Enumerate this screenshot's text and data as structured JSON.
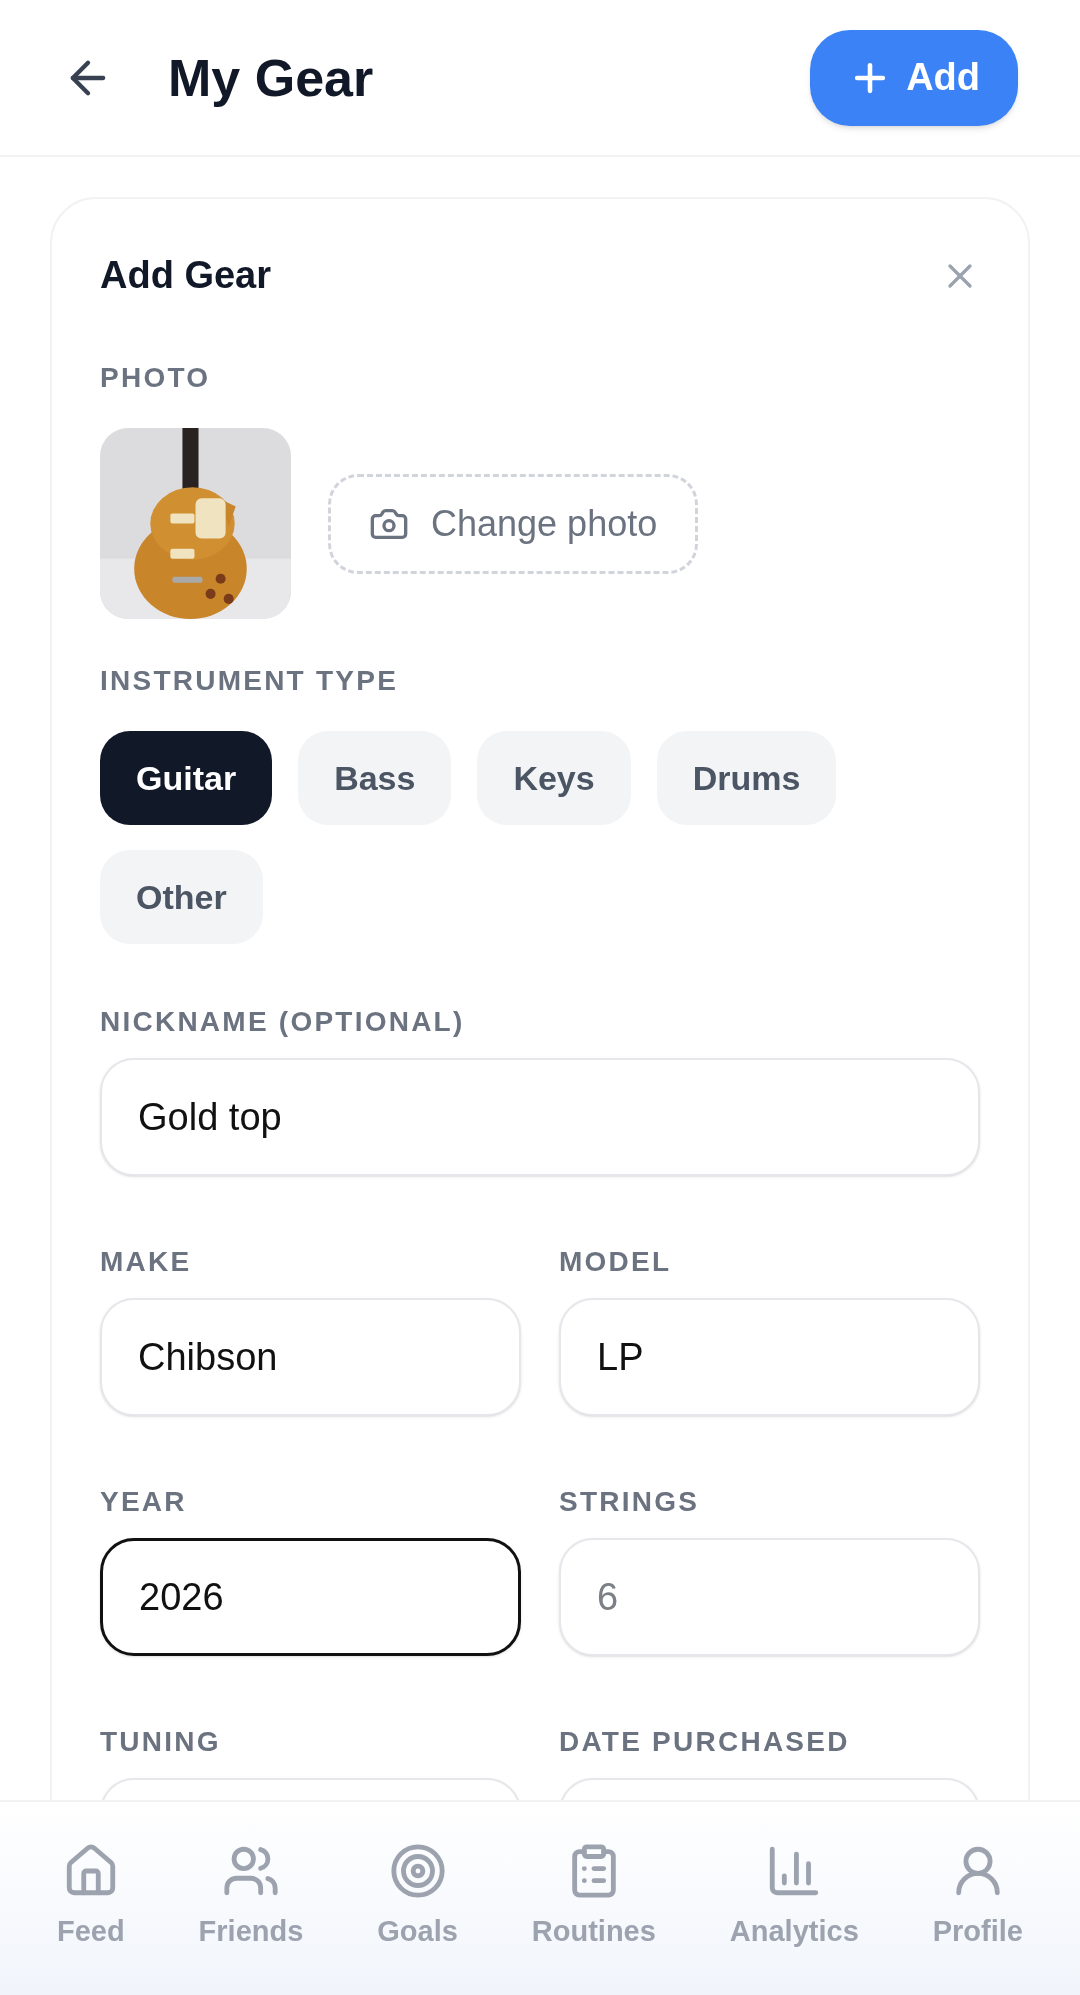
{
  "header": {
    "title": "My Gear",
    "add_button": "Add"
  },
  "form": {
    "title": "Add Gear",
    "photo_label": "PHOTO",
    "change_photo": "Change photo",
    "type_label": "INSTRUMENT TYPE",
    "types": [
      {
        "label": "Guitar",
        "selected": true
      },
      {
        "label": "Bass",
        "selected": false
      },
      {
        "label": "Keys",
        "selected": false
      },
      {
        "label": "Drums",
        "selected": false
      },
      {
        "label": "Other",
        "selected": false
      }
    ],
    "fields": [
      {
        "label": "NICKNAME (OPTIONAL)",
        "value": "Gold top",
        "focused": false,
        "wide": true
      },
      {
        "label": "MAKE",
        "value": "Chibson",
        "focused": false,
        "wide": false
      },
      {
        "label": "MODEL",
        "value": "LP",
        "focused": false,
        "wide": false
      },
      {
        "label": "YEAR",
        "value": "2026",
        "focused": true,
        "wide": false
      },
      {
        "label": "STRINGS",
        "placeholder": "6",
        "focused": false,
        "wide": false
      },
      {
        "label": "TUNING",
        "focused": false,
        "wide": false
      },
      {
        "label": "DATE PURCHASED",
        "focused": false,
        "wide": false
      }
    ]
  },
  "nav": [
    {
      "kind": "home",
      "label": "Feed"
    },
    {
      "kind": "friends",
      "label": "Friends"
    },
    {
      "kind": "goals",
      "label": "Goals"
    },
    {
      "kind": "routines",
      "label": "Routines"
    },
    {
      "kind": "analytics",
      "label": "Analytics"
    },
    {
      "kind": "profile",
      "label": "Profile"
    }
  ]
}
